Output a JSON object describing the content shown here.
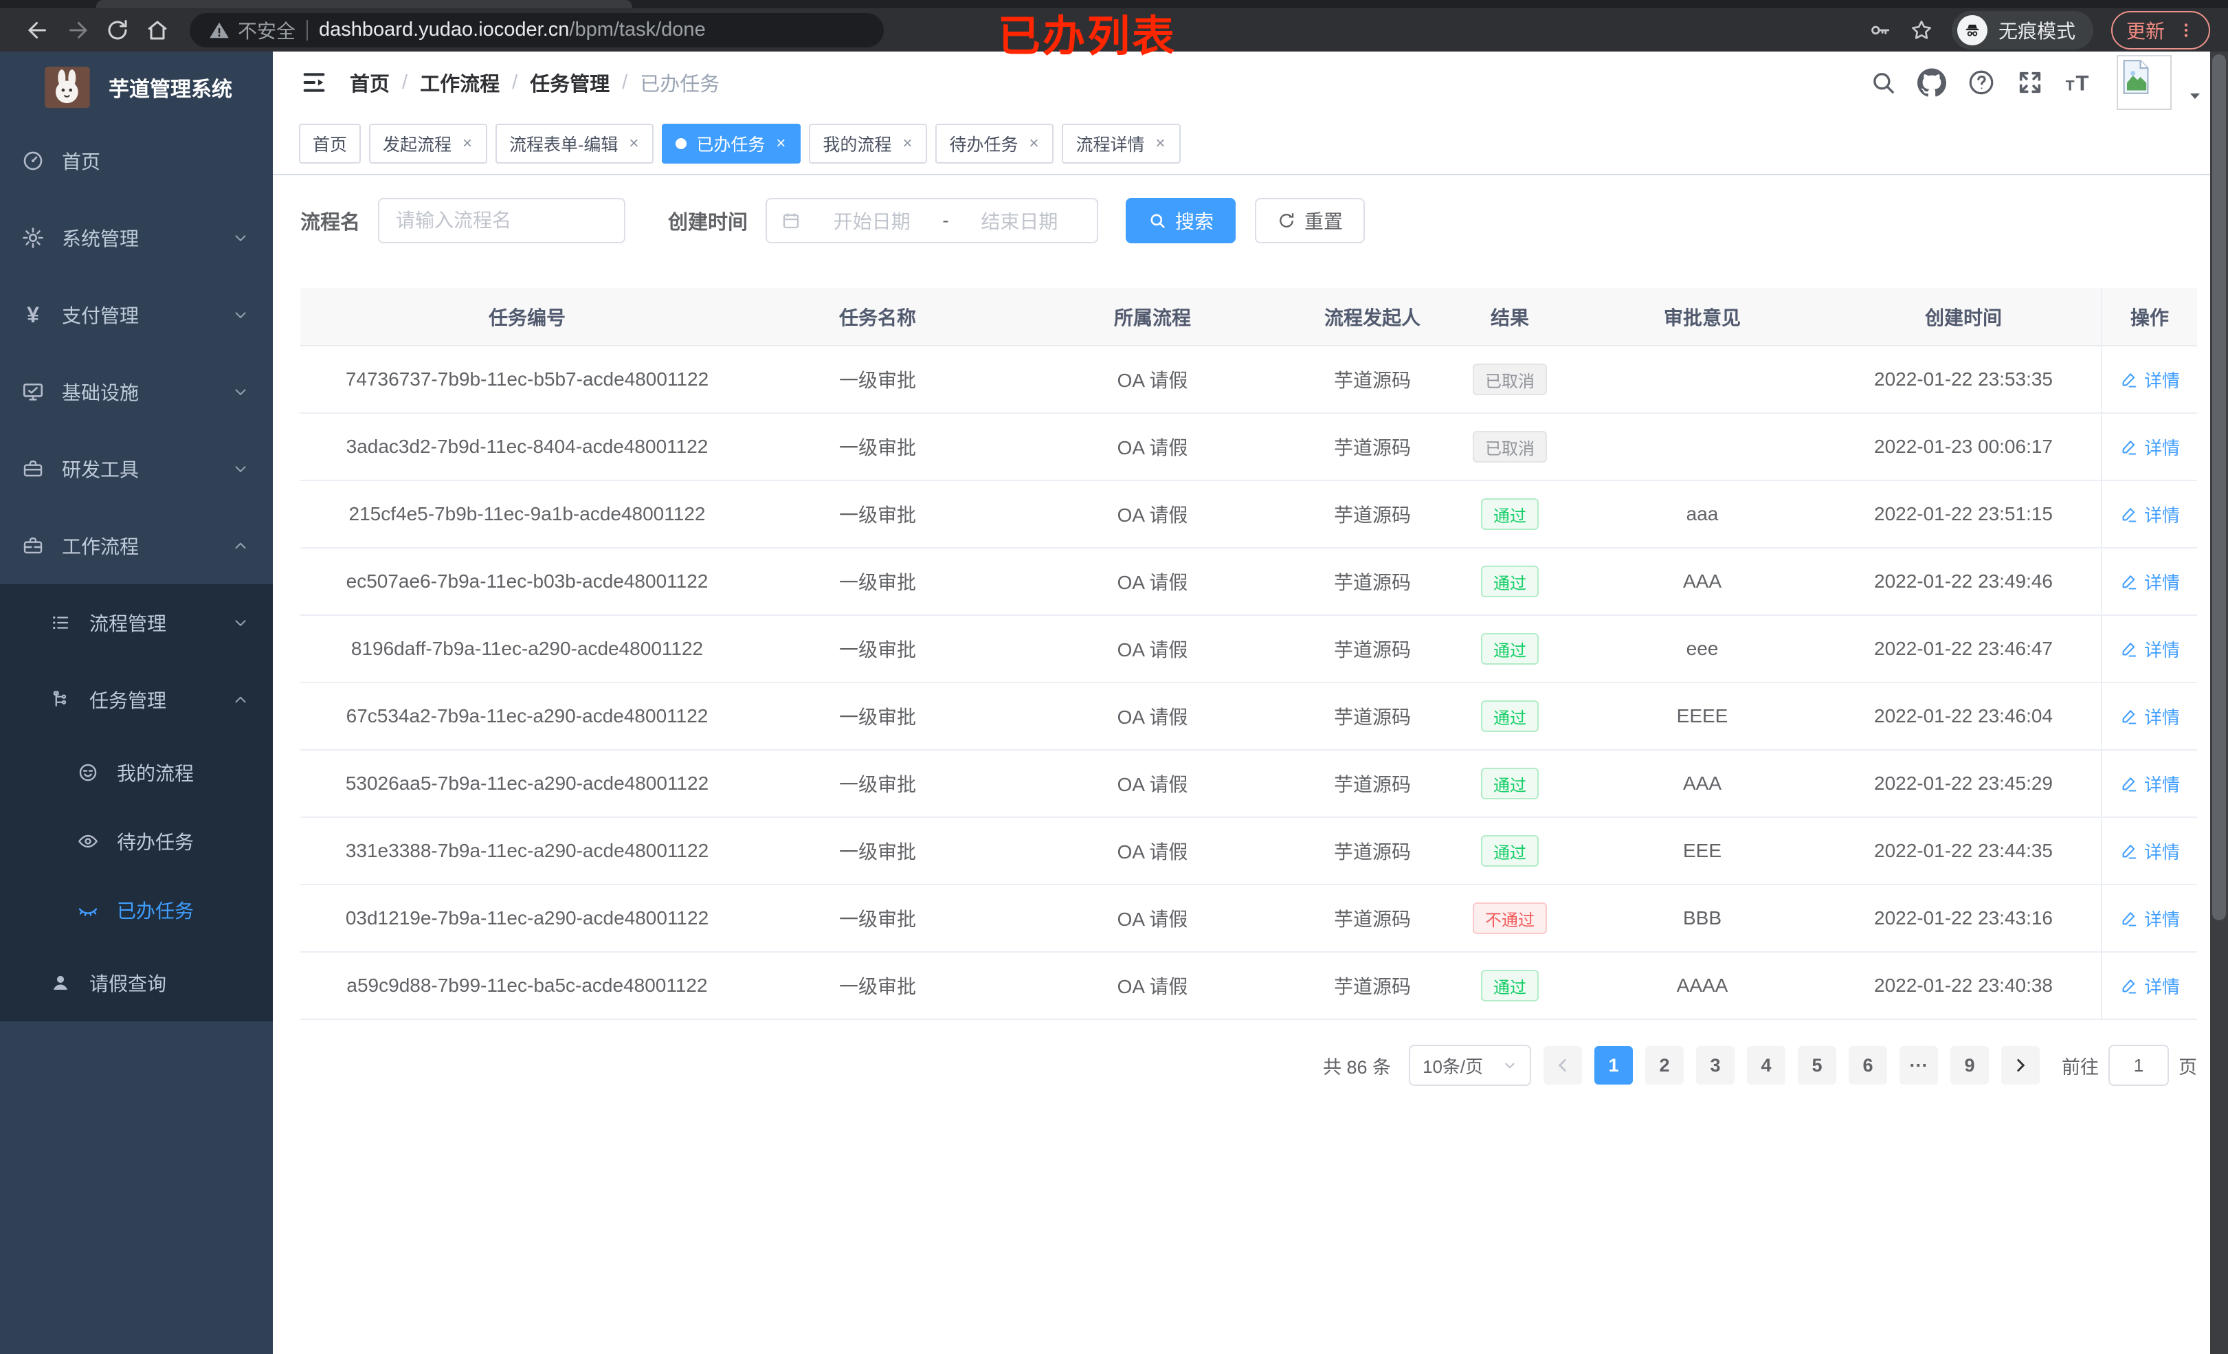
{
  "browser": {
    "security_label": "不安全",
    "url_host": "dashboard.yudao.iocoder.cn",
    "url_path": "/bpm/task/done",
    "incognito_label": "无痕模式",
    "update_label": "更新",
    "annotation": "已办列表"
  },
  "colors": {
    "accent": "#409eff",
    "sidebar_bg": "#304156",
    "submenu_bg": "#1f2d3d",
    "tab_active_bg": "#409eff",
    "success_text": "#13ce66",
    "danger_text": "#f25a5a",
    "info_text": "#909399",
    "annotation_red": "#ff2600",
    "update_button": "#f28b82"
  },
  "sidebar": {
    "app_title": "芋道管理系统",
    "logo_icon": "rabbit-logo",
    "items": [
      {
        "key": "home",
        "icon": "dashboard-icon",
        "label": "首页",
        "level": 1
      },
      {
        "key": "system",
        "icon": "gear-icon",
        "label": "系统管理",
        "level": 1,
        "chevron": "down"
      },
      {
        "key": "payment",
        "icon": "yen-icon",
        "label": "支付管理",
        "level": 1,
        "chevron": "down"
      },
      {
        "key": "infra",
        "icon": "monitor-icon",
        "label": "基础设施",
        "level": 1,
        "chevron": "down"
      },
      {
        "key": "devtools",
        "icon": "toolbox-icon",
        "label": "研发工具",
        "level": 1,
        "chevron": "down"
      },
      {
        "key": "workflow",
        "icon": "briefcase-icon",
        "label": "工作流程",
        "level": 1,
        "chevron": "up"
      },
      {
        "key": "process-mgmt",
        "icon": "list-tree-icon",
        "label": "流程管理",
        "level": 2,
        "chevron": "down",
        "sub": true
      },
      {
        "key": "task-mgmt",
        "icon": "org-tree-icon",
        "label": "任务管理",
        "level": 2,
        "chevron": "up",
        "sub": true
      },
      {
        "key": "my-process",
        "icon": "face-icon",
        "label": "我的流程",
        "level": 3,
        "sub": true
      },
      {
        "key": "todo-task",
        "icon": "eye-icon",
        "label": "待办任务",
        "level": 3,
        "sub": true
      },
      {
        "key": "done-task",
        "icon": "eye-closed-icon",
        "label": "已办任务",
        "level": 3,
        "sub": true,
        "active": true
      },
      {
        "key": "leave-query",
        "icon": "user-icon",
        "label": "请假查询",
        "level": 2,
        "sub": true
      }
    ]
  },
  "breadcrumb": [
    "首页",
    "工作流程",
    "任务管理",
    "已办任务"
  ],
  "tabs": [
    {
      "label": "首页"
    },
    {
      "label": "发起流程",
      "closable": true
    },
    {
      "label": "流程表单-编辑",
      "closable": true
    },
    {
      "label": "已办任务",
      "closable": true,
      "active": true
    },
    {
      "label": "我的流程",
      "closable": true
    },
    {
      "label": "待办任务",
      "closable": true
    },
    {
      "label": "流程详情",
      "closable": true
    }
  ],
  "filters": {
    "name_label": "流程名",
    "name_placeholder": "请输入流程名",
    "time_label": "创建时间",
    "start_placeholder": "开始日期",
    "range_separator": "-",
    "end_placeholder": "结束日期",
    "search_label": "搜索",
    "reset_label": "重置"
  },
  "table": {
    "columns": [
      "任务编号",
      "任务名称",
      "所属流程",
      "流程发起人",
      "结果",
      "审批意见",
      "创建时间",
      "操作"
    ],
    "action_label": "详情",
    "rows": [
      {
        "id": "74736737-7b9b-11ec-b5b7-acde48001122",
        "name": "一级审批",
        "process": "OA 请假",
        "starter": "芋道源码",
        "result": "已取消",
        "result_type": "info",
        "comment": "",
        "created": "2022-01-22 23:53:35"
      },
      {
        "id": "3adac3d2-7b9d-11ec-8404-acde48001122",
        "name": "一级审批",
        "process": "OA 请假",
        "starter": "芋道源码",
        "result": "已取消",
        "result_type": "info",
        "comment": "",
        "created": "2022-01-23 00:06:17"
      },
      {
        "id": "215cf4e5-7b9b-11ec-9a1b-acde48001122",
        "name": "一级审批",
        "process": "OA 请假",
        "starter": "芋道源码",
        "result": "通过",
        "result_type": "success",
        "comment": "aaa",
        "created": "2022-01-22 23:51:15"
      },
      {
        "id": "ec507ae6-7b9a-11ec-b03b-acde48001122",
        "name": "一级审批",
        "process": "OA 请假",
        "starter": "芋道源码",
        "result": "通过",
        "result_type": "success",
        "comment": "AAA",
        "created": "2022-01-22 23:49:46"
      },
      {
        "id": "8196daff-7b9a-11ec-a290-acde48001122",
        "name": "一级审批",
        "process": "OA 请假",
        "starter": "芋道源码",
        "result": "通过",
        "result_type": "success",
        "comment": "eee",
        "created": "2022-01-22 23:46:47"
      },
      {
        "id": "67c534a2-7b9a-11ec-a290-acde48001122",
        "name": "一级审批",
        "process": "OA 请假",
        "starter": "芋道源码",
        "result": "通过",
        "result_type": "success",
        "comment": "EEEE",
        "created": "2022-01-22 23:46:04"
      },
      {
        "id": "53026aa5-7b9a-11ec-a290-acde48001122",
        "name": "一级审批",
        "process": "OA 请假",
        "starter": "芋道源码",
        "result": "通过",
        "result_type": "success",
        "comment": "AAA",
        "created": "2022-01-22 23:45:29"
      },
      {
        "id": "331e3388-7b9a-11ec-a290-acde48001122",
        "name": "一级审批",
        "process": "OA 请假",
        "starter": "芋道源码",
        "result": "通过",
        "result_type": "success",
        "comment": "EEE",
        "created": "2022-01-22 23:44:35"
      },
      {
        "id": "03d1219e-7b9a-11ec-a290-acde48001122",
        "name": "一级审批",
        "process": "OA 请假",
        "starter": "芋道源码",
        "result": "不通过",
        "result_type": "danger",
        "comment": "BBB",
        "created": "2022-01-22 23:43:16"
      },
      {
        "id": "a59c9d88-7b99-11ec-ba5c-acde48001122",
        "name": "一级审批",
        "process": "OA 请假",
        "starter": "芋道源码",
        "result": "通过",
        "result_type": "success",
        "comment": "AAAA",
        "created": "2022-01-22 23:40:38"
      }
    ]
  },
  "pagination": {
    "total_label": "共 86 条",
    "page_size": "10条/页",
    "pages": [
      "1",
      "2",
      "3",
      "4",
      "5",
      "6",
      "···",
      "9"
    ],
    "active_page": "1",
    "goto_label": "前往",
    "goto_value": "1",
    "page_label": "页"
  }
}
